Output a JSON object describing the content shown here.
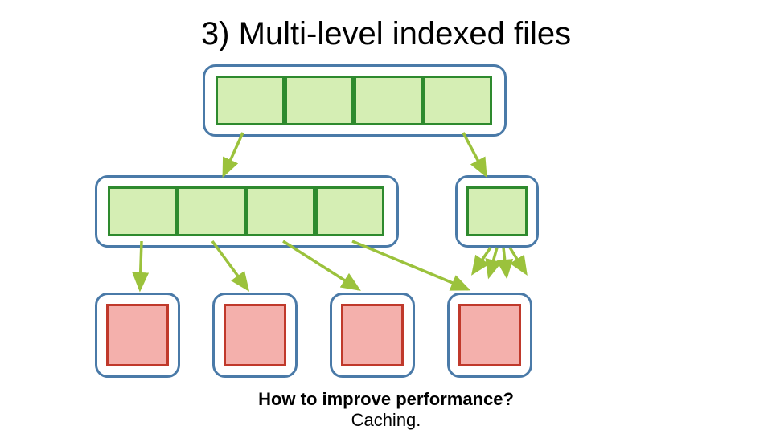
{
  "title": "3) Multi-level indexed files",
  "caption_question": "How to improve performance?",
  "caption_answer": "Caching.",
  "colors": {
    "outer_border": "#4a7aa8",
    "index_fill": "#d5eeb4",
    "index_border": "#2e8a2e",
    "data_fill": "#f4b0ac",
    "data_border": "#c0392b",
    "arrow": "#9bc23c"
  },
  "layers": {
    "top_index_cells": 4,
    "mid_left_index_cells": 4,
    "mid_right_index_cells": 1,
    "data_blocks": 4
  }
}
